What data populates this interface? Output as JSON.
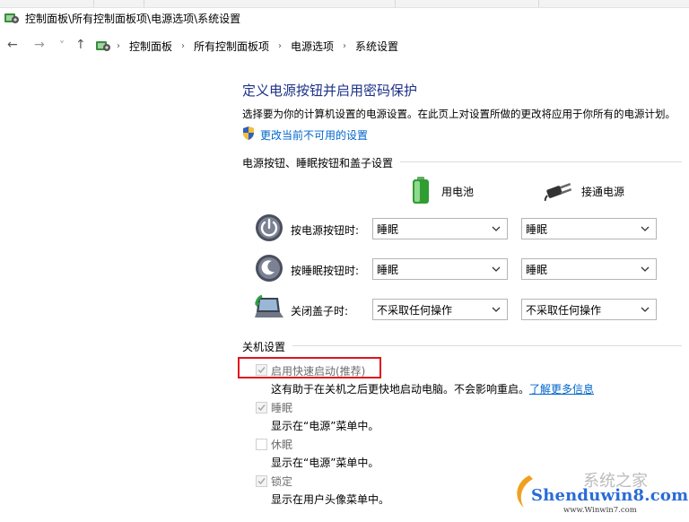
{
  "title_bar": {
    "path": "控制面板\\所有控制面板项\\电源选项\\系统设置"
  },
  "nav": {
    "back": "←",
    "forward": "→",
    "recent": "˅",
    "up": "↑",
    "breadcrumbs": [
      "控制面板",
      "所有控制面板项",
      "电源选项",
      "系统设置"
    ]
  },
  "main": {
    "heading": "定义电源按钮并启用密码保护",
    "description": "选择要为你的计算机设置的电源设置。在此页上对设置所做的更改将应用于你所有的电源计划。",
    "change_link": "更改当前不可用的设置",
    "buttons_section": {
      "title": "电源按钮、睡眠按钮和盖子设置",
      "col_battery": "用电池",
      "col_plugged": "接通电源",
      "rows": [
        {
          "label": "按电源按钮时:",
          "battery": "睡眠",
          "plugged": "睡眠"
        },
        {
          "label": "按睡眠按钮时:",
          "battery": "睡眠",
          "plugged": "睡眠"
        },
        {
          "label": "关闭盖子时:",
          "battery": "不采取任何操作",
          "plugged": "不采取任何操作"
        }
      ]
    },
    "shutdown_section": {
      "title": "关机设置",
      "options": [
        {
          "label": "启用快速启动(推荐)",
          "desc": "这有助于在关机之后更快地启动电脑。不会影响重启。",
          "link": "了解更多信息",
          "checked": true
        },
        {
          "label": "睡眠",
          "desc": "显示在“电源”菜单中。",
          "checked": true
        },
        {
          "label": "休眠",
          "desc": "显示在“电源”菜单中。",
          "checked": false
        },
        {
          "label": "锁定",
          "desc": "显示在用户头像菜单中。",
          "checked": true
        }
      ]
    }
  },
  "watermark": {
    "site": "Shenduwin8.com",
    "sub": "www.Winwin7.com",
    "top": "系统之家"
  },
  "colors": {
    "heading": "#1e3287",
    "link": "#0066cc",
    "highlight": "#e0141e"
  }
}
